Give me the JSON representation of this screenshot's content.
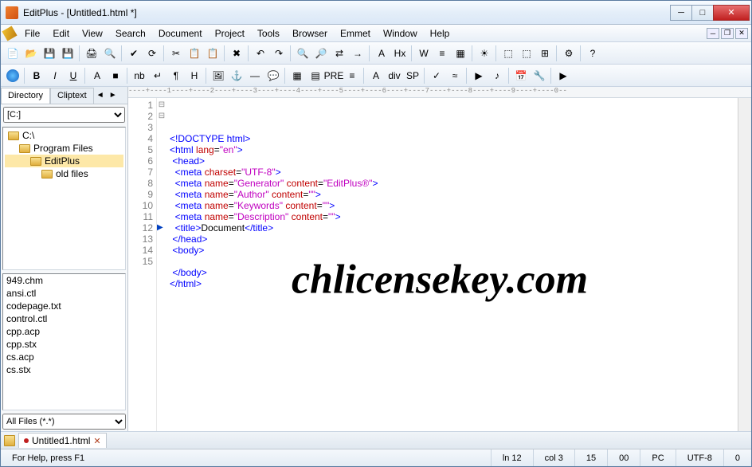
{
  "title": "EditPlus - [Untitled1.html *]",
  "menus": [
    "File",
    "Edit",
    "View",
    "Search",
    "Document",
    "Project",
    "Tools",
    "Browser",
    "Emmet",
    "Window",
    "Help"
  ],
  "sidebar": {
    "tabs": [
      "Directory",
      "Cliptext"
    ],
    "drive": "[C:]",
    "dirs": [
      {
        "label": "C:\\",
        "indent": 0,
        "sel": false
      },
      {
        "label": "Program Files",
        "indent": 1,
        "sel": false
      },
      {
        "label": "EditPlus",
        "indent": 2,
        "sel": true
      },
      {
        "label": "old files",
        "indent": 3,
        "sel": false
      }
    ],
    "files": [
      "949.chm",
      "ansi.ctl",
      "codepage.txt",
      "control.ctl",
      "cpp.acp",
      "cpp.stx",
      "cs.acp",
      "cs.stx"
    ],
    "filter": "All Files (*.*)"
  },
  "code": {
    "lines": [
      {
        "n": 1,
        "fold": "",
        "html": "<span class='c-tag'>&lt;!</span><span class='c-doctype'>DOCTYPE html</span><span class='c-tag'>&gt;</span>"
      },
      {
        "n": 2,
        "fold": "⊟",
        "html": "<span class='c-tag'>&lt;html</span> <span class='c-attr'>lang</span>=<span class='c-val'>\"en\"</span><span class='c-tag'>&gt;</span>"
      },
      {
        "n": 3,
        "fold": "⊟",
        "html": " <span class='c-tag'>&lt;head&gt;</span>"
      },
      {
        "n": 4,
        "fold": "",
        "html": "  <span class='c-tag'>&lt;meta</span> <span class='c-attr'>charset</span>=<span class='c-val'>\"UTF-8\"</span><span class='c-tag'>&gt;</span>"
      },
      {
        "n": 5,
        "fold": "",
        "html": "  <span class='c-tag'>&lt;meta</span> <span class='c-attr'>name</span>=<span class='c-val'>\"Generator\"</span> <span class='c-attr'>content</span>=<span class='c-val'>\"EditPlus®\"</span><span class='c-tag'>&gt;</span>"
      },
      {
        "n": 6,
        "fold": "",
        "html": "  <span class='c-tag'>&lt;meta</span> <span class='c-attr'>name</span>=<span class='c-val'>\"Author\"</span> <span class='c-attr'>content</span>=<span class='c-val'>\"\"</span><span class='c-tag'>&gt;</span>"
      },
      {
        "n": 7,
        "fold": "",
        "html": "  <span class='c-tag'>&lt;meta</span> <span class='c-attr'>name</span>=<span class='c-val'>\"Keywords\"</span> <span class='c-attr'>content</span>=<span class='c-val'>\"\"</span><span class='c-tag'>&gt;</span>"
      },
      {
        "n": 8,
        "fold": "",
        "html": "  <span class='c-tag'>&lt;meta</span> <span class='c-attr'>name</span>=<span class='c-val'>\"Description\"</span> <span class='c-attr'>content</span>=<span class='c-val'>\"\"</span><span class='c-tag'>&gt;</span>"
      },
      {
        "n": 9,
        "fold": "",
        "html": "  <span class='c-tag'>&lt;title&gt;</span>Document<span class='c-tag'>&lt;/title&gt;</span>"
      },
      {
        "n": 10,
        "fold": "",
        "html": " <span class='c-tag'>&lt;/head&gt;</span>"
      },
      {
        "n": 11,
        "fold": "",
        "html": " <span class='c-tag'>&lt;body&gt;</span>"
      },
      {
        "n": 12,
        "fold": "",
        "html": "  "
      },
      {
        "n": 13,
        "fold": "",
        "html": " <span class='c-tag'>&lt;/body&gt;</span>"
      },
      {
        "n": 14,
        "fold": "",
        "html": "<span class='c-tag'>&lt;/html&gt;</span>"
      },
      {
        "n": 15,
        "fold": "",
        "html": ""
      }
    ]
  },
  "ruler": "----+----1----+----2----+----3----+----4----+----5----+----6----+----7----+----8----+----9----+----0--",
  "watermark": "chlicensekey.com",
  "doctab": {
    "label": "Untitled1.html"
  },
  "status": {
    "help": "For Help, press F1",
    "ln": "ln 12",
    "col": "col 3",
    "c15": "15",
    "c00": "00",
    "mode": "PC",
    "enc": "UTF-8",
    "zero": "0"
  },
  "toolbar1_icons": [
    "new",
    "open",
    "save",
    "saveall",
    "|",
    "print",
    "preview",
    "|",
    "spell",
    "refresh",
    "|",
    "cut",
    "copy",
    "paste",
    "|",
    "delete",
    "|",
    "undo",
    "redo",
    "|",
    "find",
    "findfiles",
    "replace",
    "goto",
    "|",
    "fontdown",
    "fontup",
    "|",
    "wrap",
    "wrapmode",
    "column",
    "|",
    "browser",
    "|",
    "split",
    "splitv",
    "tile",
    "|",
    "settings",
    "|",
    "help"
  ],
  "toolbar2_icons": [
    "globe",
    "|",
    "bold",
    "italic",
    "underline",
    "|",
    "font",
    "color",
    "|",
    "nbsp",
    "break",
    "para",
    "heading",
    "|",
    "image",
    "anchor",
    "hr",
    "comment",
    "|",
    "table",
    "form",
    "pre",
    "list",
    "|",
    "char",
    "div",
    "sp",
    "|",
    "validate",
    "tidy",
    "|",
    "play",
    "music",
    "|",
    "date",
    "tools",
    "|",
    "run"
  ]
}
